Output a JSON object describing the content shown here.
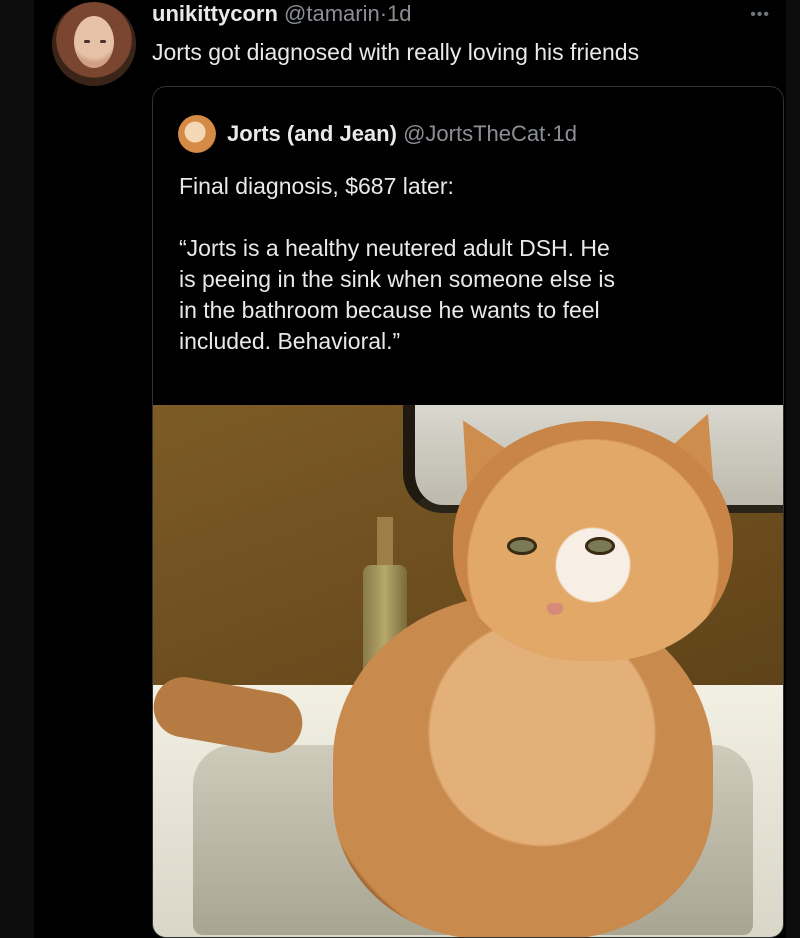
{
  "post": {
    "username": "unikittycorn",
    "handle": "@tamarin",
    "time_separator": "·",
    "time": "1d",
    "more": "•••",
    "text": "Jorts got diagnosed with really loving his friends"
  },
  "quote": {
    "name": "Jorts (and Jean)",
    "handle": "@JortsTheCat",
    "time_separator": "·",
    "time": "1d",
    "line1": "Final diagnosis, $687 later:",
    "line2": "“Jorts is a healthy neutered adult DSH. He",
    "line3": "is peeing in the sink when someone else is",
    "line4": "in the bathroom because he wants to feel",
    "line5": "included. Behavioral.”"
  },
  "colors": {
    "background": "#000000",
    "text": "#e7e9ea",
    "secondary_text": "#8b8f94",
    "border": "#2f3336"
  },
  "icons": {
    "more": "more-horizontal-icon"
  }
}
